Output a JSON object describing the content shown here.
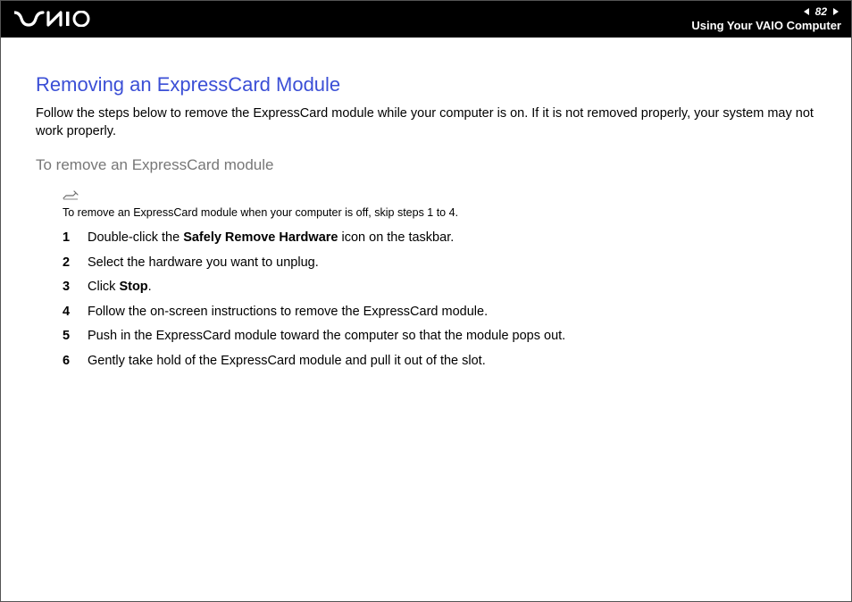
{
  "header": {
    "page_number": "82",
    "section_title": "Using Your VAIO Computer"
  },
  "content": {
    "title": "Removing an ExpressCard Module",
    "intro": "Follow the steps below to remove the ExpressCard module while your computer is on. If it is not removed properly, your system may not work properly.",
    "subtitle": "To remove an ExpressCard module",
    "note": "To remove an ExpressCard module when your computer is off, skip steps 1 to 4.",
    "steps": [
      {
        "num": "1",
        "pre": "Double-click the ",
        "bold": "Safely Remove Hardware",
        "post": " icon on the taskbar."
      },
      {
        "num": "2",
        "pre": "Select the hardware you want to unplug.",
        "bold": "",
        "post": ""
      },
      {
        "num": "3",
        "pre": "Click ",
        "bold": "Stop",
        "post": "."
      },
      {
        "num": "4",
        "pre": "Follow the on-screen instructions to remove the ExpressCard module.",
        "bold": "",
        "post": ""
      },
      {
        "num": "5",
        "pre": "Push in the ExpressCard module toward the computer so that the module pops out.",
        "bold": "",
        "post": ""
      },
      {
        "num": "6",
        "pre": "Gently take hold of the ExpressCard module and pull it out of the slot.",
        "bold": "",
        "post": ""
      }
    ]
  }
}
